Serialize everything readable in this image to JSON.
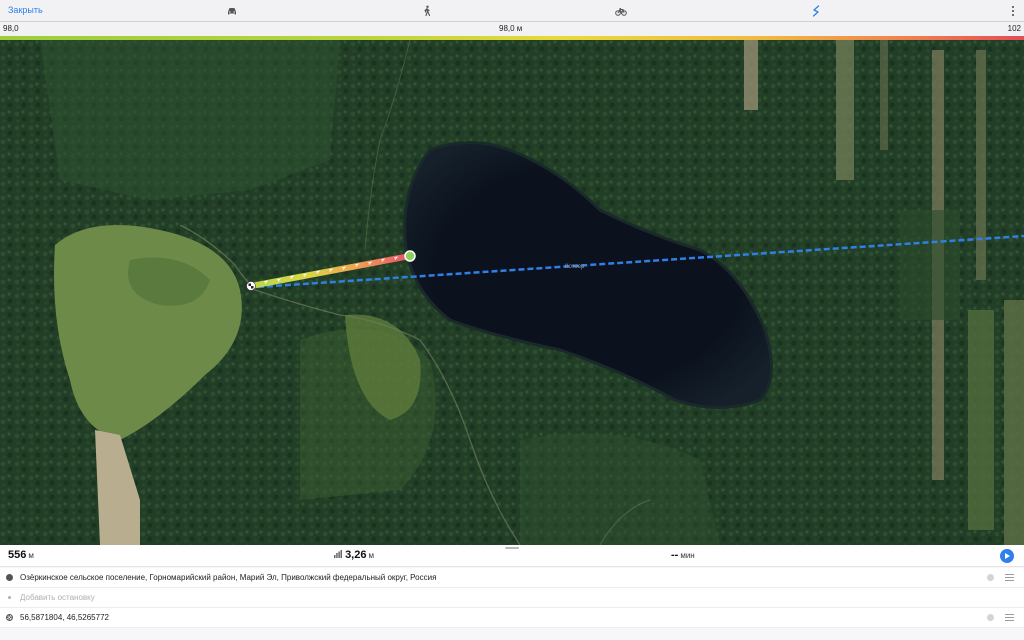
{
  "toolbar": {
    "close_label": "Закрыть",
    "modes": [
      {
        "icon": "car-icon",
        "active": false
      },
      {
        "icon": "pedestrian-icon",
        "active": false
      },
      {
        "icon": "bicycle-icon",
        "active": false
      },
      {
        "icon": "straight-line-icon",
        "active": true
      }
    ],
    "more_icon": "more-vertical-icon"
  },
  "elevation": {
    "start": "98,0",
    "current": "98,0 м",
    "end": "102"
  },
  "map": {
    "lake_name": "Котоер",
    "route_color_start": "#b9d64a",
    "route_color_end": "#e8526a",
    "straight_line_color": "#2f7fe6"
  },
  "summary": {
    "distance_value": "556",
    "distance_unit": "м",
    "ascent_value": "3,26",
    "ascent_unit": "м",
    "time_value": "--",
    "time_unit": "мин",
    "ascent_icon": "elevation-chart-icon",
    "play_icon": "play-icon"
  },
  "stops": [
    {
      "kind": "start",
      "text": "Озёркинское сельское поселение, Горномарийский район, Марий Эл, Приволжский федеральный округ, Россия"
    },
    {
      "kind": "add",
      "text": "Добавить остановку"
    },
    {
      "kind": "finish",
      "text": "56,5871804, 46,5265772"
    }
  ],
  "colors": {
    "accent": "#2f80ed",
    "forest": "#233f27",
    "lake": "#0c1420"
  }
}
